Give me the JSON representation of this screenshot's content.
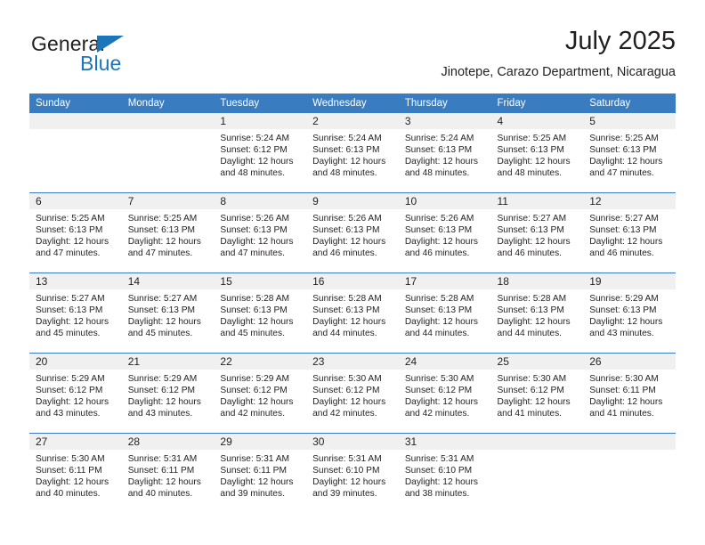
{
  "logo": {
    "primary_text": "General",
    "secondary_text": "Blue",
    "triangle_color": "#1b75bb",
    "primary_color": "#231f20",
    "secondary_color": "#1b75bb"
  },
  "header": {
    "month_title": "July 2025",
    "location": "Jinotepe, Carazo Department, Nicaragua"
  },
  "theme": {
    "header_bar": "#3a7cc0",
    "daynum_band": "#f0f0f0",
    "text": "#231f20",
    "row_rule": "#3a7cc0"
  },
  "weekdays": [
    "Sunday",
    "Monday",
    "Tuesday",
    "Wednesday",
    "Thursday",
    "Friday",
    "Saturday"
  ],
  "labels": {
    "sunrise_prefix": "Sunrise:",
    "sunset_prefix": "Sunset:",
    "daylight_prefix": "Daylight:"
  },
  "weeks": [
    [
      {
        "day": "",
        "blank": true
      },
      {
        "day": "",
        "blank": true
      },
      {
        "day": "1",
        "sunrise": "Sunrise: 5:24 AM",
        "sunset": "Sunset: 6:12 PM",
        "daylight_line1": "Daylight: 12 hours",
        "daylight_line2": "and 48 minutes."
      },
      {
        "day": "2",
        "sunrise": "Sunrise: 5:24 AM",
        "sunset": "Sunset: 6:13 PM",
        "daylight_line1": "Daylight: 12 hours",
        "daylight_line2": "and 48 minutes."
      },
      {
        "day": "3",
        "sunrise": "Sunrise: 5:24 AM",
        "sunset": "Sunset: 6:13 PM",
        "daylight_line1": "Daylight: 12 hours",
        "daylight_line2": "and 48 minutes."
      },
      {
        "day": "4",
        "sunrise": "Sunrise: 5:25 AM",
        "sunset": "Sunset: 6:13 PM",
        "daylight_line1": "Daylight: 12 hours",
        "daylight_line2": "and 48 minutes."
      },
      {
        "day": "5",
        "sunrise": "Sunrise: 5:25 AM",
        "sunset": "Sunset: 6:13 PM",
        "daylight_line1": "Daylight: 12 hours",
        "daylight_line2": "and 47 minutes."
      }
    ],
    [
      {
        "day": "6",
        "sunrise": "Sunrise: 5:25 AM",
        "sunset": "Sunset: 6:13 PM",
        "daylight_line1": "Daylight: 12 hours",
        "daylight_line2": "and 47 minutes."
      },
      {
        "day": "7",
        "sunrise": "Sunrise: 5:25 AM",
        "sunset": "Sunset: 6:13 PM",
        "daylight_line1": "Daylight: 12 hours",
        "daylight_line2": "and 47 minutes."
      },
      {
        "day": "8",
        "sunrise": "Sunrise: 5:26 AM",
        "sunset": "Sunset: 6:13 PM",
        "daylight_line1": "Daylight: 12 hours",
        "daylight_line2": "and 47 minutes."
      },
      {
        "day": "9",
        "sunrise": "Sunrise: 5:26 AM",
        "sunset": "Sunset: 6:13 PM",
        "daylight_line1": "Daylight: 12 hours",
        "daylight_line2": "and 46 minutes."
      },
      {
        "day": "10",
        "sunrise": "Sunrise: 5:26 AM",
        "sunset": "Sunset: 6:13 PM",
        "daylight_line1": "Daylight: 12 hours",
        "daylight_line2": "and 46 minutes."
      },
      {
        "day": "11",
        "sunrise": "Sunrise: 5:27 AM",
        "sunset": "Sunset: 6:13 PM",
        "daylight_line1": "Daylight: 12 hours",
        "daylight_line2": "and 46 minutes."
      },
      {
        "day": "12",
        "sunrise": "Sunrise: 5:27 AM",
        "sunset": "Sunset: 6:13 PM",
        "daylight_line1": "Daylight: 12 hours",
        "daylight_line2": "and 46 minutes."
      }
    ],
    [
      {
        "day": "13",
        "sunrise": "Sunrise: 5:27 AM",
        "sunset": "Sunset: 6:13 PM",
        "daylight_line1": "Daylight: 12 hours",
        "daylight_line2": "and 45 minutes."
      },
      {
        "day": "14",
        "sunrise": "Sunrise: 5:27 AM",
        "sunset": "Sunset: 6:13 PM",
        "daylight_line1": "Daylight: 12 hours",
        "daylight_line2": "and 45 minutes."
      },
      {
        "day": "15",
        "sunrise": "Sunrise: 5:28 AM",
        "sunset": "Sunset: 6:13 PM",
        "daylight_line1": "Daylight: 12 hours",
        "daylight_line2": "and 45 minutes."
      },
      {
        "day": "16",
        "sunrise": "Sunrise: 5:28 AM",
        "sunset": "Sunset: 6:13 PM",
        "daylight_line1": "Daylight: 12 hours",
        "daylight_line2": "and 44 minutes."
      },
      {
        "day": "17",
        "sunrise": "Sunrise: 5:28 AM",
        "sunset": "Sunset: 6:13 PM",
        "daylight_line1": "Daylight: 12 hours",
        "daylight_line2": "and 44 minutes."
      },
      {
        "day": "18",
        "sunrise": "Sunrise: 5:28 AM",
        "sunset": "Sunset: 6:13 PM",
        "daylight_line1": "Daylight: 12 hours",
        "daylight_line2": "and 44 minutes."
      },
      {
        "day": "19",
        "sunrise": "Sunrise: 5:29 AM",
        "sunset": "Sunset: 6:13 PM",
        "daylight_line1": "Daylight: 12 hours",
        "daylight_line2": "and 43 minutes."
      }
    ],
    [
      {
        "day": "20",
        "sunrise": "Sunrise: 5:29 AM",
        "sunset": "Sunset: 6:12 PM",
        "daylight_line1": "Daylight: 12 hours",
        "daylight_line2": "and 43 minutes."
      },
      {
        "day": "21",
        "sunrise": "Sunrise: 5:29 AM",
        "sunset": "Sunset: 6:12 PM",
        "daylight_line1": "Daylight: 12 hours",
        "daylight_line2": "and 43 minutes."
      },
      {
        "day": "22",
        "sunrise": "Sunrise: 5:29 AM",
        "sunset": "Sunset: 6:12 PM",
        "daylight_line1": "Daylight: 12 hours",
        "daylight_line2": "and 42 minutes."
      },
      {
        "day": "23",
        "sunrise": "Sunrise: 5:30 AM",
        "sunset": "Sunset: 6:12 PM",
        "daylight_line1": "Daylight: 12 hours",
        "daylight_line2": "and 42 minutes."
      },
      {
        "day": "24",
        "sunrise": "Sunrise: 5:30 AM",
        "sunset": "Sunset: 6:12 PM",
        "daylight_line1": "Daylight: 12 hours",
        "daylight_line2": "and 42 minutes."
      },
      {
        "day": "25",
        "sunrise": "Sunrise: 5:30 AM",
        "sunset": "Sunset: 6:12 PM",
        "daylight_line1": "Daylight: 12 hours",
        "daylight_line2": "and 41 minutes."
      },
      {
        "day": "26",
        "sunrise": "Sunrise: 5:30 AM",
        "sunset": "Sunset: 6:11 PM",
        "daylight_line1": "Daylight: 12 hours",
        "daylight_line2": "and 41 minutes."
      }
    ],
    [
      {
        "day": "27",
        "sunrise": "Sunrise: 5:30 AM",
        "sunset": "Sunset: 6:11 PM",
        "daylight_line1": "Daylight: 12 hours",
        "daylight_line2": "and 40 minutes."
      },
      {
        "day": "28",
        "sunrise": "Sunrise: 5:31 AM",
        "sunset": "Sunset: 6:11 PM",
        "daylight_line1": "Daylight: 12 hours",
        "daylight_line2": "and 40 minutes."
      },
      {
        "day": "29",
        "sunrise": "Sunrise: 5:31 AM",
        "sunset": "Sunset: 6:11 PM",
        "daylight_line1": "Daylight: 12 hours",
        "daylight_line2": "and 39 minutes."
      },
      {
        "day": "30",
        "sunrise": "Sunrise: 5:31 AM",
        "sunset": "Sunset: 6:10 PM",
        "daylight_line1": "Daylight: 12 hours",
        "daylight_line2": "and 39 minutes."
      },
      {
        "day": "31",
        "sunrise": "Sunrise: 5:31 AM",
        "sunset": "Sunset: 6:10 PM",
        "daylight_line1": "Daylight: 12 hours",
        "daylight_line2": "and 38 minutes."
      },
      {
        "day": "",
        "blank": true
      },
      {
        "day": "",
        "blank": true
      }
    ]
  ]
}
